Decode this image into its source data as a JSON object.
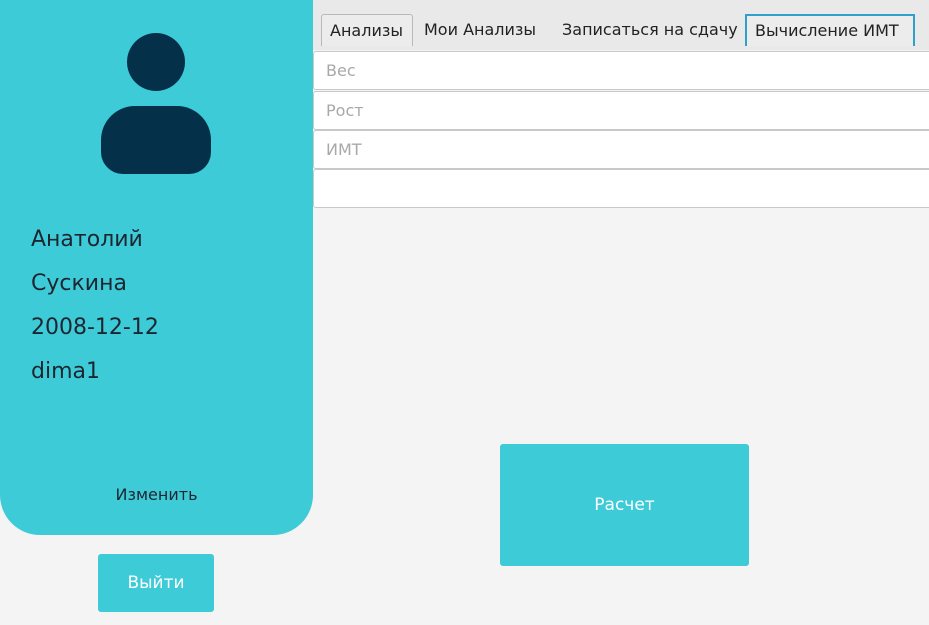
{
  "profile": {
    "first_name": "Анатолий",
    "last_name": "Сускина",
    "birth_date": "2008-12-12",
    "login": "dima1",
    "edit_label": "Изменить",
    "logout_label": "Выйти"
  },
  "tabs": [
    {
      "label": "Анализы"
    },
    {
      "label": "Мои Анализы"
    },
    {
      "label": "Записаться на сдачу"
    },
    {
      "label": "Вычисление ИМТ",
      "active": true
    }
  ],
  "form": {
    "weight_placeholder": "Вес",
    "height_placeholder": "Рост",
    "bmi_placeholder": "ИМТ",
    "result_value": "",
    "calculate_label": "Расчет"
  },
  "colors": {
    "accent": "#3ecbd8",
    "avatar": "#05304a",
    "active_tab_border": "#2f9fcd"
  },
  "icons": {
    "avatar": "user-silhouette-icon"
  }
}
